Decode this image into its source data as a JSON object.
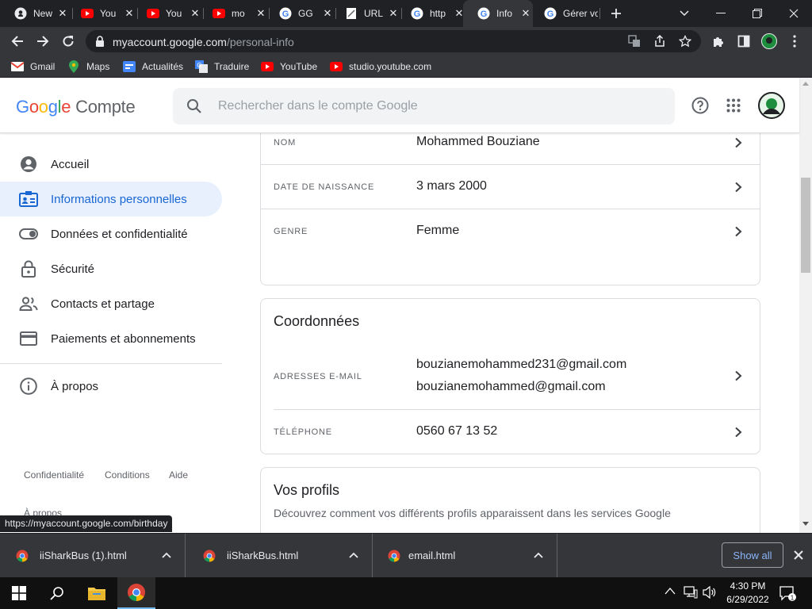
{
  "tabs": [
    {
      "title": "New",
      "icon": "github-icon"
    },
    {
      "title": "You",
      "icon": "youtube-icon"
    },
    {
      "title": "You",
      "icon": "youtube-icon"
    },
    {
      "title": "mo",
      "icon": "youtube-icon"
    },
    {
      "title": "GG",
      "icon": "google-icon"
    },
    {
      "title": "URL",
      "icon": "page-icon"
    },
    {
      "title": "http",
      "icon": "google-icon"
    },
    {
      "title": "Info",
      "icon": "google-icon",
      "active": true
    },
    {
      "title": "Gérer vo",
      "icon": "google-icon"
    }
  ],
  "address": {
    "host": "myaccount.google.com",
    "path": "/personal-info"
  },
  "bookmarks": [
    {
      "label": "Gmail",
      "icon": "gmail-icon"
    },
    {
      "label": "Maps",
      "icon": "maps-icon"
    },
    {
      "label": "Actualités",
      "icon": "news-icon"
    },
    {
      "label": "Traduire",
      "icon": "translate-icon"
    },
    {
      "label": "YouTube",
      "icon": "youtube-icon"
    },
    {
      "label": "studio.youtube.com",
      "icon": "youtube-icon"
    }
  ],
  "header": {
    "brand_google": "Google",
    "brand_product": "Compte",
    "search_placeholder": "Rechercher dans le compte Google"
  },
  "sidebar": {
    "items": [
      {
        "label": "Accueil",
        "icon": "account-circle-icon"
      },
      {
        "label": "Informations personnelles",
        "icon": "id-card-icon",
        "selected": true
      },
      {
        "label": "Données et confidentialité",
        "icon": "toggle-icon"
      },
      {
        "label": "Sécurité",
        "icon": "lock-icon"
      },
      {
        "label": "Contacts et partage",
        "icon": "people-icon"
      },
      {
        "label": "Paiements et abonnements",
        "icon": "credit-card-icon"
      }
    ],
    "about": {
      "label": "À propos",
      "icon": "info-icon"
    },
    "footer": [
      "Confidentialité",
      "Conditions",
      "Aide"
    ],
    "footer_about": "À propos"
  },
  "basic_info": [
    {
      "label": "Nom",
      "value": "Mohammed Bouziane"
    },
    {
      "label": "Date de naissance",
      "value": "3 mars 2000"
    },
    {
      "label": "Genre",
      "value": "Femme"
    }
  ],
  "contact": {
    "title": "Coordonnées",
    "email_label": "Adresses e-mail",
    "emails": [
      "bouzianemohammed231@gmail.com",
      "bouzianemohammed@gmail.com"
    ],
    "phone_label": "Téléphone",
    "phone": "0560 67 13 52"
  },
  "profiles": {
    "title": "Vos profils",
    "subtitle": "Découvrez comment vos différents profils apparaissent dans les services Google"
  },
  "status_url": "https://myaccount.google.com/birthday",
  "downloads": {
    "items": [
      "iiSharkBus (1).html",
      "iiSharkBus.html",
      "email.html"
    ],
    "show_all": "Show all"
  },
  "clock": {
    "time": "4:30 PM",
    "date": "6/29/2022"
  },
  "colors": {
    "accent": "#1a73e8",
    "selected_bg": "#e8f0fe",
    "selected_text": "#1967d2"
  }
}
